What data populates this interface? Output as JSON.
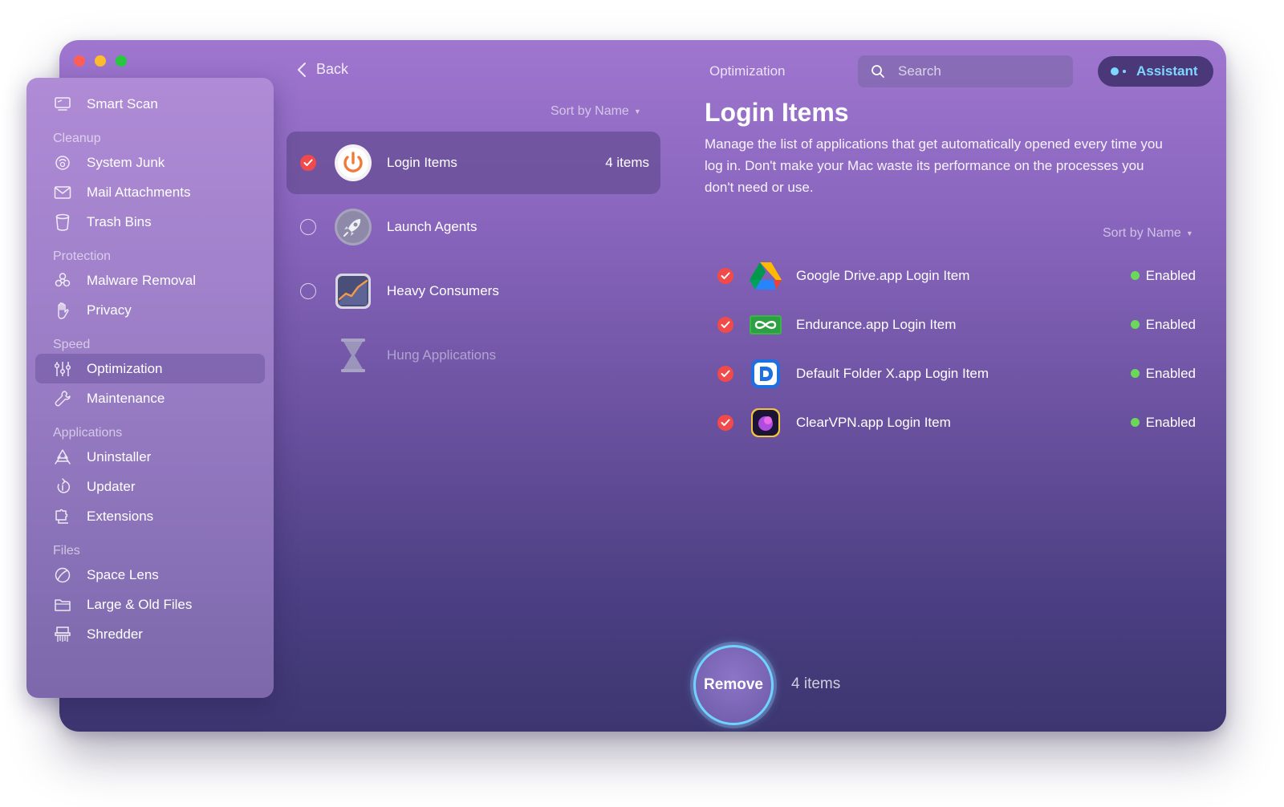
{
  "window": {
    "view_title": "Optimization",
    "back_label": "Back",
    "search": {
      "placeholder": "Search"
    },
    "assistant_label": "Assistant"
  },
  "sidebar": {
    "top_item": {
      "label": "Smart Scan",
      "icon": "monitor-icon"
    },
    "sections": [
      {
        "title": "Cleanup",
        "items": [
          {
            "label": "System Junk",
            "icon": "broom-icon"
          },
          {
            "label": "Mail Attachments",
            "icon": "envelope-icon"
          },
          {
            "label": "Trash Bins",
            "icon": "trash-icon"
          }
        ]
      },
      {
        "title": "Protection",
        "items": [
          {
            "label": "Malware Removal",
            "icon": "biohazard-icon"
          },
          {
            "label": "Privacy",
            "icon": "hand-icon"
          }
        ]
      },
      {
        "title": "Speed",
        "items": [
          {
            "label": "Optimization",
            "icon": "sliders-icon",
            "active": true
          },
          {
            "label": "Maintenance",
            "icon": "wrench-icon"
          }
        ]
      },
      {
        "title": "Applications",
        "items": [
          {
            "label": "Uninstaller",
            "icon": "uninstaller-icon"
          },
          {
            "label": "Updater",
            "icon": "update-arrow-icon"
          },
          {
            "label": "Extensions",
            "icon": "puzzle-icon"
          }
        ]
      },
      {
        "title": "Files",
        "items": [
          {
            "label": "Space Lens",
            "icon": "lens-icon"
          },
          {
            "label": "Large & Old Files",
            "icon": "folder-icon"
          },
          {
            "label": "Shredder",
            "icon": "shredder-icon"
          }
        ]
      }
    ]
  },
  "categories": {
    "sort_label": "Sort by Name",
    "items": [
      {
        "label": "Login Items",
        "count": "4 items",
        "icon": "power-icon",
        "state": "checked",
        "active": true
      },
      {
        "label": "Launch Agents",
        "count": "",
        "icon": "rocket-icon",
        "state": "unchecked"
      },
      {
        "label": "Heavy Consumers",
        "count": "",
        "icon": "chart-icon",
        "state": "unchecked"
      },
      {
        "label": "Hung Applications",
        "count": "",
        "icon": "hourglass-icon",
        "state": "disabled"
      }
    ]
  },
  "detail": {
    "title": "Login Items",
    "description": "Manage the list of applications that get automatically opened every time you log in. Don't make your Mac waste its performance on the processes you don't need or use.",
    "sort_label": "Sort by Name",
    "items": [
      {
        "name": "Google Drive.app Login Item",
        "status": "Enabled",
        "icon": "google-drive-icon"
      },
      {
        "name": "Endurance.app Login Item",
        "status": "Enabled",
        "icon": "endurance-icon"
      },
      {
        "name": "Default Folder X.app Login Item",
        "status": "Enabled",
        "icon": "default-folder-icon"
      },
      {
        "name": "ClearVPN.app Login Item",
        "status": "Enabled",
        "icon": "clearvpn-icon"
      }
    ]
  },
  "footer": {
    "remove_label": "Remove",
    "count": "4 items"
  },
  "colors": {
    "accent": "#6fd2ff",
    "check": "#f04a4a",
    "enabled": "#6bd85a"
  }
}
